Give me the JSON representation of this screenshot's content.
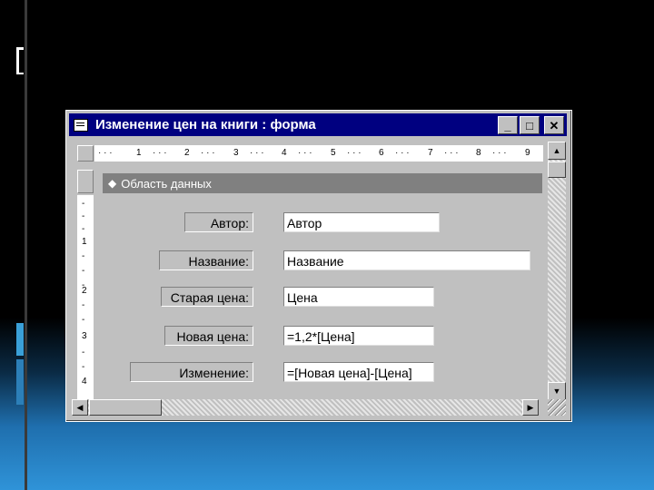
{
  "window": {
    "title": "Изменение цен на книги : форма",
    "minimize_glyph": "_",
    "maximize_glyph": "□",
    "close_glyph": "✕"
  },
  "ruler": {
    "horizontal_marks": [
      "1",
      "2",
      "3",
      "4",
      "5",
      "6",
      "7",
      "8",
      "9"
    ],
    "vertical_marks": [
      "1",
      "2",
      "3",
      "4"
    ]
  },
  "section": {
    "icon": "section-marker-icon",
    "label": "Область данных"
  },
  "form": {
    "fields": [
      {
        "label": "Автор:",
        "value": "Автор"
      },
      {
        "label": "Название:",
        "value": "Название"
      },
      {
        "label": "Старая цена:",
        "value": "Цена"
      },
      {
        "label": "Новая цена:",
        "value": "=1,2*[Цена]"
      },
      {
        "label": "Изменение:",
        "value": "=[Новая цена]-[Цена]"
      }
    ]
  },
  "scrollbars": {
    "up_glyph": "▲",
    "down_glyph": "▼",
    "left_glyph": "◀",
    "right_glyph": "▶"
  },
  "colors": {
    "titlebar": "#000080",
    "window_face": "#c0c0c0",
    "section_header": "#808080"
  }
}
